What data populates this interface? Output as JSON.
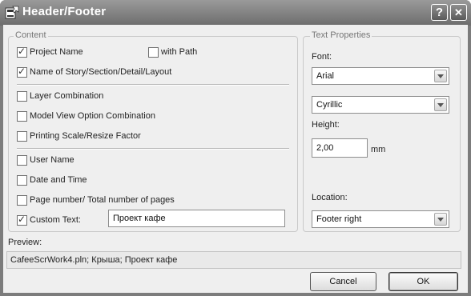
{
  "window": {
    "title": "Header/Footer",
    "help_button": "?",
    "close_button": "✕"
  },
  "content_group": {
    "legend": "Content",
    "project_name": {
      "label": "Project Name",
      "checked": true
    },
    "with_path": {
      "label": "with Path",
      "checked": false
    },
    "name_of_story": {
      "label": "Name of Story/Section/Detail/Layout",
      "checked": true
    },
    "layer_combination": {
      "label": "Layer Combination",
      "checked": false
    },
    "model_view_option": {
      "label": "Model View Option Combination",
      "checked": false
    },
    "printing_scale": {
      "label": "Printing Scale/Resize Factor",
      "checked": false
    },
    "user_name": {
      "label": "User Name",
      "checked": false
    },
    "date_time": {
      "label": "Date and Time",
      "checked": false
    },
    "page_number": {
      "label": "Page number/ Total number of pages",
      "checked": false
    },
    "custom_text": {
      "label": "Custom Text:",
      "checked": true,
      "value": "Проект кафе"
    }
  },
  "text_properties": {
    "legend": "Text Properties",
    "font_label": "Font:",
    "font_value": "Arial",
    "script_value": "Cyrillic",
    "height_label": "Height:",
    "height_value": "2,00",
    "height_unit": "mm",
    "location_label": "Location:",
    "location_value": "Footer right"
  },
  "preview": {
    "label": "Preview:",
    "text": "CafeeScrWork4.pln; Крыша; Проект кафе"
  },
  "buttons": {
    "cancel": "Cancel",
    "ok": "OK"
  }
}
